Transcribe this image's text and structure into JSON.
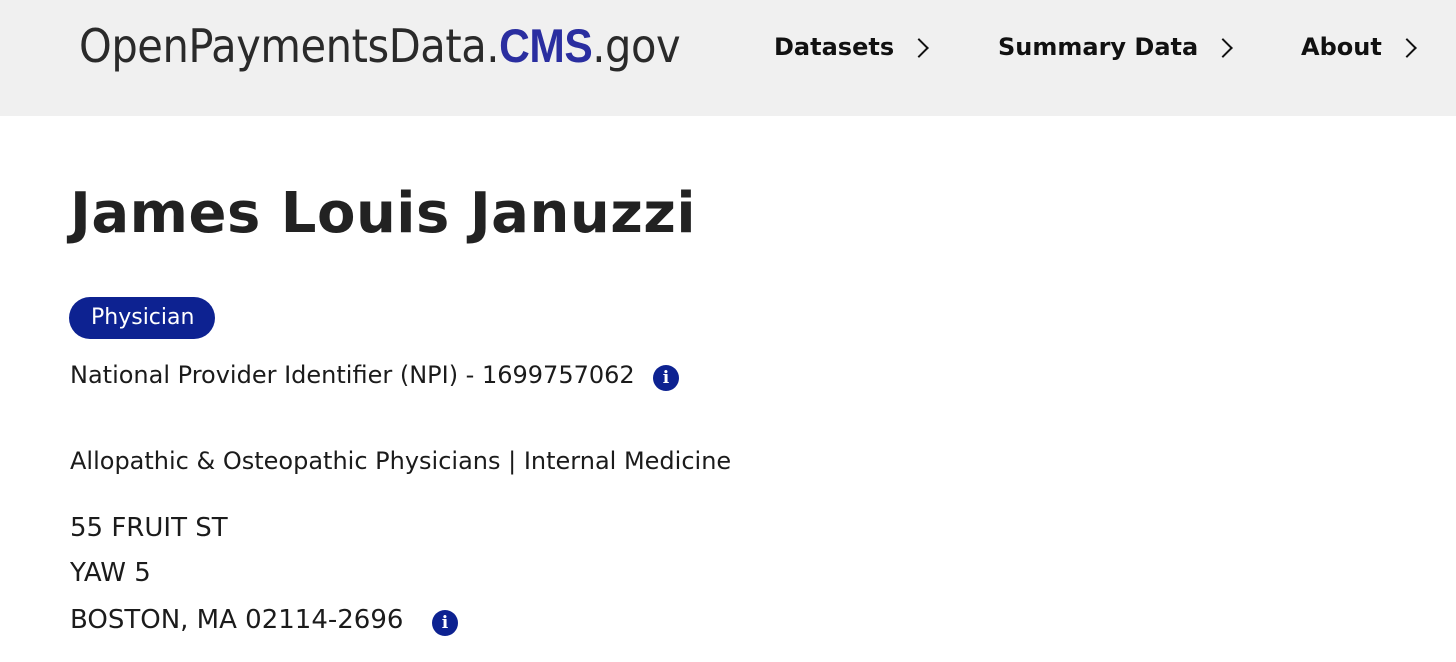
{
  "header": {
    "logo": {
      "part1": "OpenPaymentsData.",
      "part2": "CMS",
      "part3": ".gov"
    },
    "nav": [
      {
        "label": "Datasets"
      },
      {
        "label": "Summary Data"
      },
      {
        "label": "About"
      }
    ]
  },
  "profile": {
    "name": "James Louis Januzzi",
    "badge": "Physician",
    "npi_line": "National Provider Identifier (NPI) - 1699757062",
    "specialty": "Allopathic & Osteopathic Physicians | Internal Medicine",
    "address": {
      "line1": "55 FRUIT ST",
      "line2": "YAW 5",
      "line3": "BOSTON, MA 02114-2696"
    },
    "info_glyph": "i"
  },
  "colors": {
    "header_bg": "#f0f0f0",
    "brand_blue": "#2a2ea0",
    "badge_bg": "#0d2291"
  }
}
